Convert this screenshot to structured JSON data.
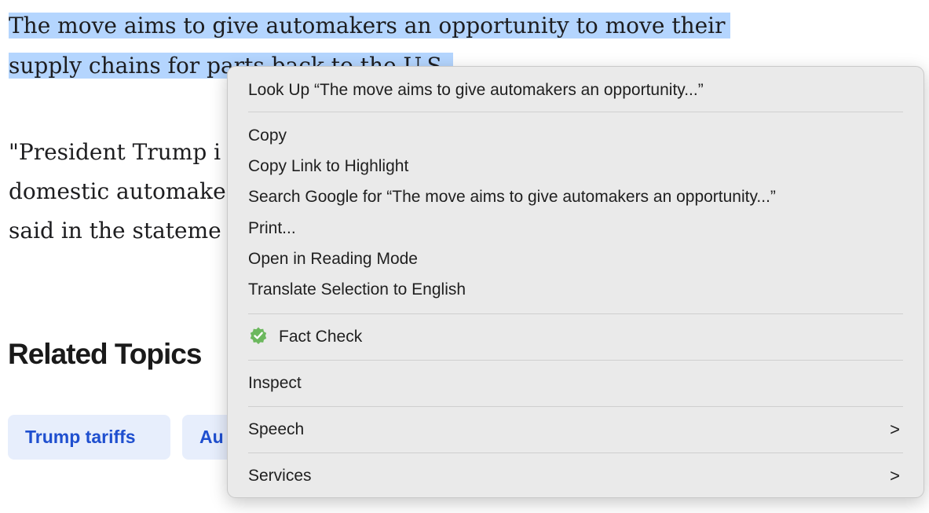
{
  "article": {
    "line1": "The move aims to give automakers an opportunity to move their",
    "line2": "supply chains for parts back to the U.S.",
    "line3": "\"President Trump i",
    "line4": "domestic automake",
    "line5": "said in the stateme"
  },
  "related": {
    "title": "Related Topics",
    "chips": [
      "Trump tariffs",
      "Au"
    ]
  },
  "context_menu": {
    "look_up": "Look Up “The move aims to give automakers an opportunity...”",
    "copy": "Copy",
    "copy_link": "Copy Link to Highlight",
    "search_google": "Search Google for “The move aims to give automakers an opportunity...”",
    "print": "Print...",
    "reading_mode": "Open in Reading Mode",
    "translate": "Translate Selection to English",
    "fact_check": "Fact Check",
    "fact_check_icon": "green-verified-badge-icon",
    "inspect": "Inspect",
    "speech": "Speech",
    "services": "Services",
    "submenu_glyph": ">"
  },
  "colors": {
    "selection": "#b4d5fe",
    "menu_bg": "#eaeaea",
    "chip_bg": "#e7eefc",
    "chip_text": "#1f4fcf",
    "fact_check_green": "#5cb85c"
  }
}
